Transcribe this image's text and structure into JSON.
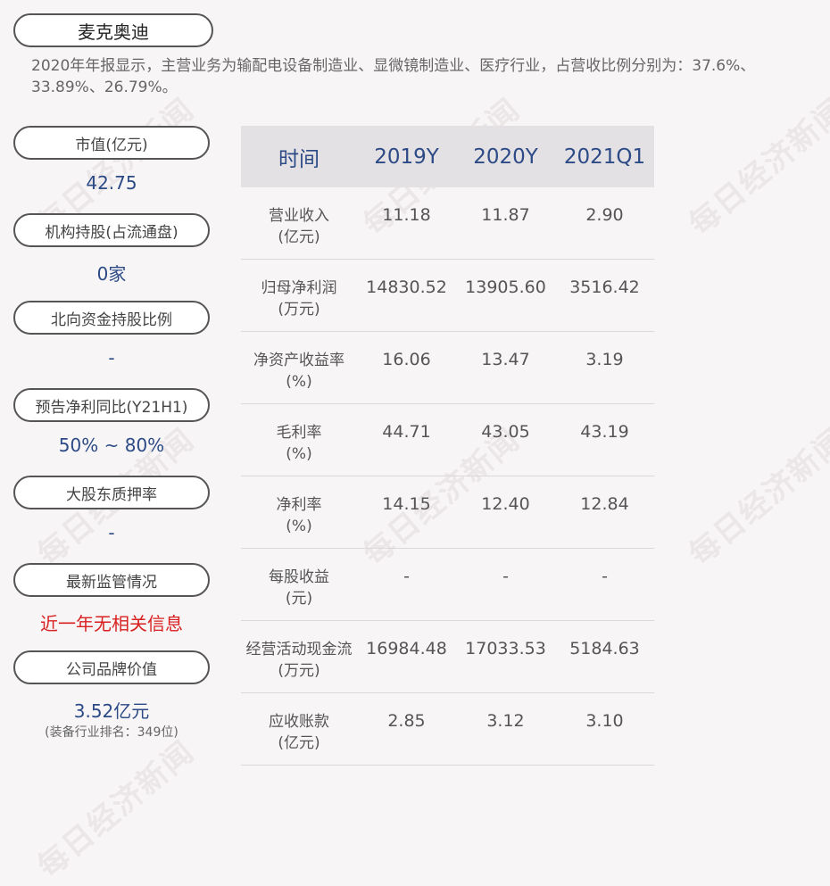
{
  "company": "麦克奥迪",
  "summary": "2020年年报显示，主营业务为输配电设备制造业、显微镜制造业、医疗行业，占营收比例分别为：37.6%、33.89%、26.79%。",
  "watermark": "每日经济新闻",
  "metrics": [
    {
      "label": "市值(亿元)",
      "value": "42.75"
    },
    {
      "label": "机构持股(占流通盘)",
      "value": "0家"
    },
    {
      "label": "北向资金持股比例",
      "value": "-"
    },
    {
      "label": "预告净利同比(Y21H1)",
      "value": "50% ~ 80%"
    },
    {
      "label": "大股东质押率",
      "value": "-"
    },
    {
      "label": "最新监管情况",
      "value": "近一年无相关信息"
    },
    {
      "label": "公司品牌价值",
      "value": "3.52亿元",
      "note": "(装备行业排名：349位)"
    }
  ],
  "table": {
    "headers": [
      "时间",
      "2019Y",
      "2020Y",
      "2021Q1"
    ],
    "rows": [
      {
        "label": "营业收入",
        "unit": "(亿元)",
        "values": [
          "11.18",
          "11.87",
          "2.90"
        ]
      },
      {
        "label": "归母净利润",
        "unit": "(万元)",
        "values": [
          "14830.52",
          "13905.60",
          "3516.42"
        ]
      },
      {
        "label": "净资产收益率",
        "unit": "(%)",
        "values": [
          "16.06",
          "13.47",
          "3.19"
        ]
      },
      {
        "label": "毛利率",
        "unit": "(%)",
        "values": [
          "44.71",
          "43.05",
          "43.19"
        ]
      },
      {
        "label": "净利率",
        "unit": "(%)",
        "values": [
          "14.15",
          "12.40",
          "12.84"
        ]
      },
      {
        "label": "每股收益",
        "unit": "(元)",
        "values": [
          "-",
          "-",
          "-"
        ]
      },
      {
        "label": "经营活动现金流",
        "unit": "(万元)",
        "values": [
          "16984.48",
          "17033.53",
          "5184.63"
        ]
      },
      {
        "label": "应收账款",
        "unit": "(亿元)",
        "values": [
          "2.85",
          "3.12",
          "3.10"
        ]
      }
    ]
  },
  "colors": {
    "accent": "#2c4a86",
    "alert": "#d82020",
    "header_bg": "#e4e1e4"
  }
}
